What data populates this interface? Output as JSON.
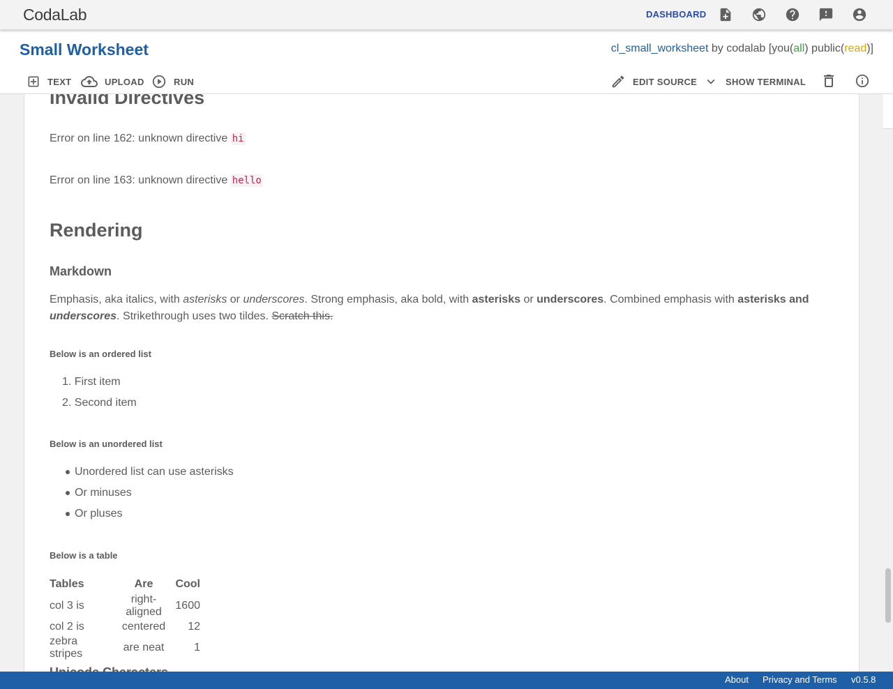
{
  "topnav": {
    "logo": "CodaLab",
    "dashboard": "DASHBOARD",
    "icons": [
      "new-worksheet-icon",
      "globe-icon",
      "help-icon",
      "feedback-icon",
      "account-icon"
    ]
  },
  "header": {
    "title": "Small Worksheet",
    "uuid": "cl_small_worksheet",
    "by": "by codalab",
    "perm_open": "[you(",
    "perm_all": "all",
    "perm_mid": ") public(",
    "perm_read": "read",
    "perm_close": ")]"
  },
  "toolbar": {
    "text": "TEXT",
    "upload": "UPLOAD",
    "run": "RUN",
    "edit_source": "EDIT SOURCE",
    "show_terminal": "SHOW TERMINAL"
  },
  "content": {
    "invalid_heading": "Invalid Directives",
    "err1_prefix": "Error on line 162: unknown directive ",
    "err1_code": "hi",
    "err2_prefix": "Error on line 163: unknown directive ",
    "err2_code": "hello",
    "rendering_heading": "Rendering",
    "markdown_heading": "Markdown",
    "md": {
      "a": "Emphasis, aka italics, with ",
      "b": "asterisks",
      "c": " or ",
      "d": "underscores",
      "e": ". Strong emphasis, aka bold, with ",
      "f": "asterisks",
      "g": " or ",
      "h": "underscores",
      "i": ". Combined emphasis with ",
      "j": "asterisks and ",
      "k": "underscores",
      "l": ". Strikethrough uses two tildes. ",
      "m": "Scratch this."
    },
    "ordered_heading": "Below is an ordered list",
    "ordered": [
      "First item",
      "Second item"
    ],
    "unordered_heading": "Below is an unordered list",
    "unordered": [
      "Unordered list can use asterisks",
      "Or minuses",
      "Or pluses"
    ],
    "table_heading": "Below is a table",
    "table": {
      "headers": [
        "Tables",
        "Are",
        "Cool"
      ],
      "rows": [
        [
          "col 3 is",
          "right-aligned",
          "1600"
        ],
        [
          "col 2 is",
          "centered",
          "12"
        ],
        [
          "zebra stripes",
          "are neat",
          "1"
        ]
      ]
    },
    "unicode_heading": "Unicode Characters"
  },
  "footer": {
    "about": "About",
    "privacy": "Privacy and Terms",
    "version": "v0.5.8"
  }
}
